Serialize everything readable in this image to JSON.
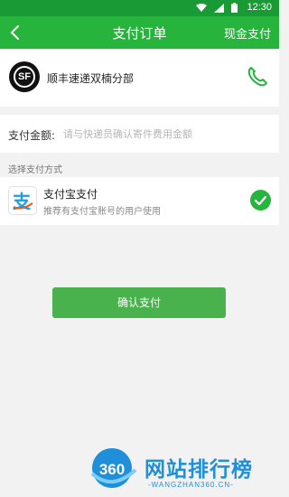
{
  "status_bar": {
    "time": "12:30",
    "icons": [
      "wifi-icon",
      "signal-icon",
      "battery-icon"
    ]
  },
  "header": {
    "title": "支付订单",
    "action_label": "现金支付",
    "back_icon": "chevron-left-icon"
  },
  "courier": {
    "logo_text": "SF",
    "name": "顺丰速递双楠分部",
    "phone_icon": "phone-icon"
  },
  "amount": {
    "label": "支付金额:",
    "value": "",
    "placeholder": "请与快递员确认寄件费用金额"
  },
  "payment": {
    "section_title": "选择支付方式",
    "method_title": "支付宝支付",
    "method_subtitle": "推荐有支付宝账号的用户使用",
    "selected": true
  },
  "confirm_label": "确认支付",
  "watermark": {
    "badge_text": "360",
    "title": "网站排行榜",
    "subtitle": "-WANGZHAN360.CN-"
  },
  "colors": {
    "brand_green": "#27b43c",
    "status_green": "#1a9a35",
    "button_green": "#49b24d",
    "watermark_blue": "#1e8fd8",
    "alipay_blue": "#1a9fe0"
  }
}
